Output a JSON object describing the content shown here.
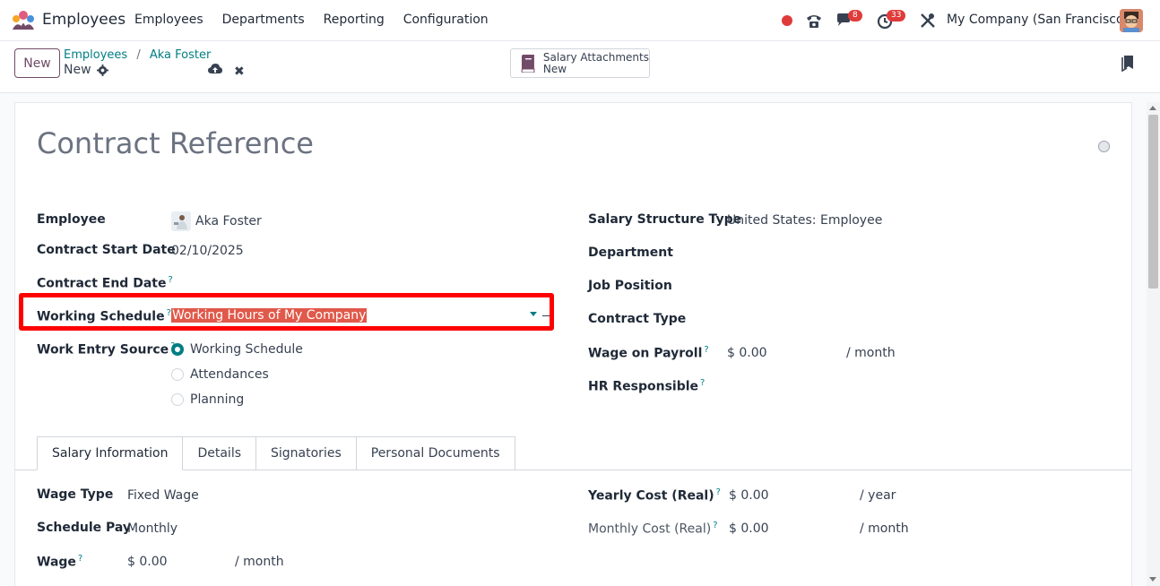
{
  "app": {
    "title": "Employees"
  },
  "nav": [
    "Employees",
    "Departments",
    "Reporting",
    "Configuration"
  ],
  "systray": {
    "messages_count": "8",
    "activities_count": "33",
    "company": "My Company (San Francisco)"
  },
  "control": {
    "new_label": "New",
    "breadcrumb": [
      "Employees",
      "Aka Foster"
    ],
    "record_label": "New",
    "smart_button": {
      "label": "Salary Attachments",
      "value": "New"
    }
  },
  "form": {
    "title_placeholder": "Contract Reference",
    "left": {
      "employee": {
        "label": "Employee",
        "value": "Aka Foster"
      },
      "start_date": {
        "label": "Contract Start Date",
        "value": "02/10/2025"
      },
      "end_date": {
        "label": "Contract End Date",
        "help": "?"
      },
      "working_schedule": {
        "label": "Working Schedule",
        "help": "?",
        "value": "Working Hours of My Company"
      },
      "work_entry_source": {
        "label": "Work Entry Source",
        "help": "?",
        "options": [
          "Working Schedule",
          "Attendances",
          "Planning"
        ],
        "selected": "Working Schedule"
      }
    },
    "right": {
      "salary_structure": {
        "label": "Salary Structure Type",
        "value": "United States: Employee"
      },
      "department": {
        "label": "Department"
      },
      "job_position": {
        "label": "Job Position"
      },
      "contract_type": {
        "label": "Contract Type"
      },
      "wage_on_payroll": {
        "label": "Wage on Payroll",
        "help": "?",
        "value": "$ 0.00",
        "unit": "/ month"
      },
      "hr_responsible": {
        "label": "HR Responsible",
        "help": "?"
      }
    },
    "tabs": [
      "Salary Information",
      "Details",
      "Signatories",
      "Personal Documents"
    ],
    "salary": {
      "wage_type": {
        "label": "Wage Type",
        "value": "Fixed Wage"
      },
      "schedule_pay": {
        "label": "Schedule Pay",
        "value": "Monthly"
      },
      "wage": {
        "label": "Wage",
        "help": "?",
        "value": "$ 0.00",
        "unit": "/ month"
      },
      "yearly_cost": {
        "label": "Yearly Cost (Real)",
        "help": "?",
        "value": "$ 0.00",
        "unit": "/ year"
      },
      "monthly_cost": {
        "label": "Monthly Cost (Real)",
        "help": "?",
        "value": "$ 0.00",
        "unit": "/ month"
      }
    }
  },
  "colors": {
    "brand": "#714b67",
    "accent": "#017e84",
    "highlight": "#ff0000",
    "selection": "#e0594a"
  },
  "icons": [
    "employees-app-icon",
    "record-icon",
    "phone-icon",
    "chat-icon",
    "clock-icon",
    "tools-icon",
    "gear-icon",
    "cloud-upload-icon",
    "close-icon",
    "book-icon",
    "bookmark-icon"
  ]
}
